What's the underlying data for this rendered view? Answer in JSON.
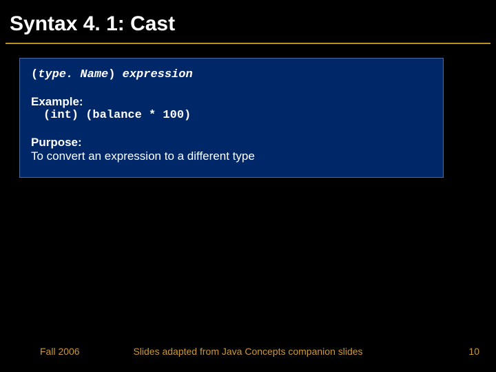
{
  "title": "Syntax 4. 1: Cast",
  "box": {
    "syntax_open": "(",
    "syntax_typename": "type. Name",
    "syntax_close": ")",
    "syntax_expression": " expression",
    "example_label": "Example:",
    "example_code": "(int) (balance * 100)",
    "purpose_label": "Purpose:",
    "purpose_text": "To convert an expression to a different type"
  },
  "footer": {
    "left": "Fall 2006",
    "center": "Slides adapted from Java Concepts companion slides",
    "right": "10"
  }
}
